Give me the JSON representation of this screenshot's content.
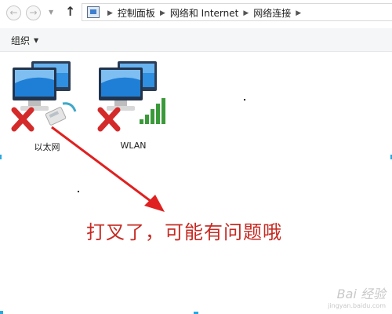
{
  "window": {
    "breadcrumbs": [
      "控制面板",
      "网络和 Internet",
      "网络连接"
    ]
  },
  "toolbar": {
    "organize_label": "组织"
  },
  "adapters": [
    {
      "label": "以太网",
      "status": "disconnected",
      "type": "ethernet"
    },
    {
      "label": "WLAN",
      "status": "disconnected",
      "type": "wireless"
    }
  ],
  "annotation": {
    "text": "打叉了，可能有问题哦",
    "color": "#c62a22"
  },
  "watermark": {
    "brand": "Bai 经验",
    "url": "jingyan.baidu.com"
  },
  "icons": {
    "back": "back-arrow-icon",
    "forward": "forward-arrow-icon",
    "up": "up-arrow-icon",
    "location": "control-panel-icon",
    "error": "red-x-icon"
  }
}
